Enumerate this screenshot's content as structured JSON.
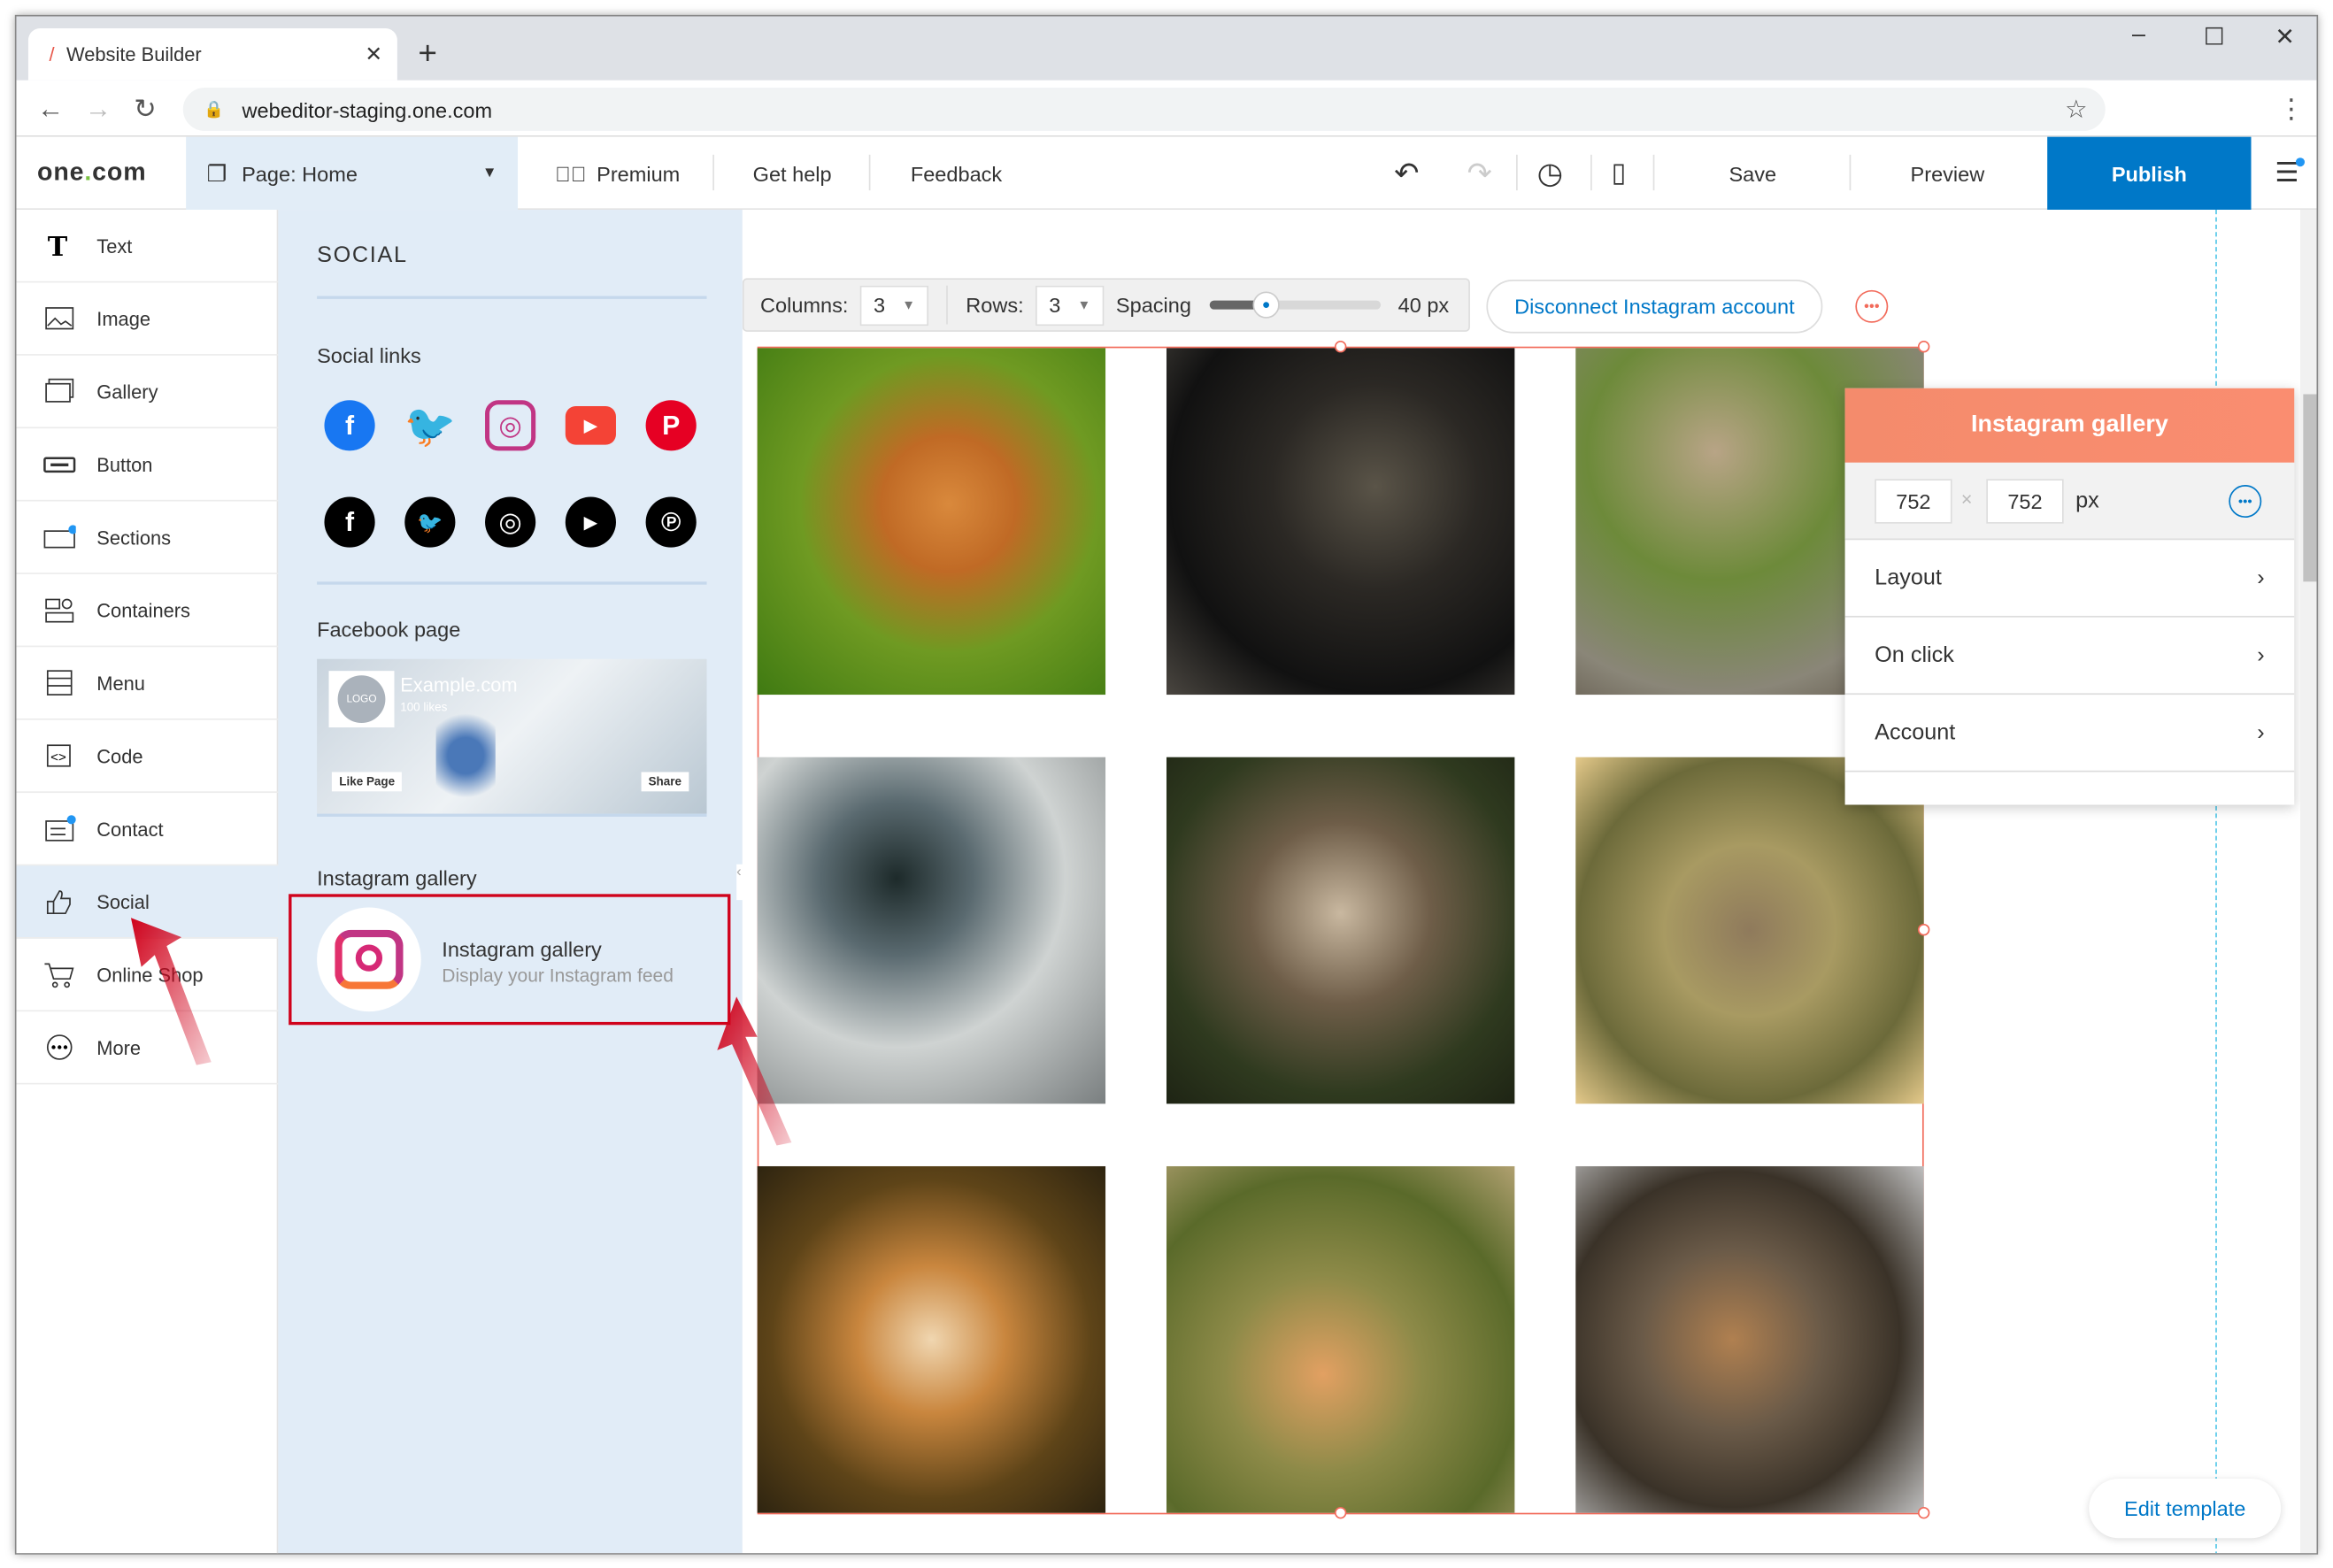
{
  "browser": {
    "tab_title": "Website Builder",
    "url": "webeditor-staging.one.com"
  },
  "header": {
    "logo": "one.com",
    "page_select": "Page: Home",
    "premium": "Premium",
    "get_help": "Get help",
    "feedback": "Feedback",
    "save": "Save",
    "preview": "Preview",
    "publish": "Publish"
  },
  "sidebar": {
    "items": [
      {
        "label": "Text",
        "icon": "text-icon"
      },
      {
        "label": "Image",
        "icon": "image-icon"
      },
      {
        "label": "Gallery",
        "icon": "gallery-icon"
      },
      {
        "label": "Button",
        "icon": "button-icon"
      },
      {
        "label": "Sections",
        "icon": "sections-icon"
      },
      {
        "label": "Containers",
        "icon": "containers-icon"
      },
      {
        "label": "Menu",
        "icon": "menu-icon"
      },
      {
        "label": "Code",
        "icon": "code-icon"
      },
      {
        "label": "Contact",
        "icon": "contact-icon"
      },
      {
        "label": "Social",
        "icon": "thumbs-up-icon",
        "active": true
      },
      {
        "label": "Online Shop",
        "icon": "cart-icon"
      },
      {
        "label": "More",
        "icon": "more-icon"
      }
    ]
  },
  "panel": {
    "title": "SOCIAL",
    "social_links": "Social links",
    "facebook_page": "Facebook page",
    "fb_preview": {
      "logo": "LOGO",
      "name": "Example.com",
      "likes": "100 likes",
      "like_page": "Like Page",
      "share": "Share"
    },
    "instagram_section": "Instagram gallery",
    "instagram_card": {
      "title": "Instagram gallery",
      "subtitle": "Display your Instagram feed"
    }
  },
  "toolbar": {
    "columns_label": "Columns:",
    "columns_value": "3",
    "rows_label": "Rows:",
    "rows_value": "3",
    "spacing_label": "Spacing",
    "spacing_value": "40 px",
    "spacing_level": 0.33,
    "disconnect": "Disconnect Instagram account"
  },
  "instagram_panel": {
    "title": "Instagram gallery",
    "width": "752",
    "height": "752",
    "unit": "px",
    "times": "×",
    "rows": [
      "Layout",
      "On click",
      "Account"
    ]
  },
  "edit_template": "Edit template",
  "colors": {
    "accent": "#0078c8",
    "selection": "#f26b5b",
    "panel_bg": "#e1ecf7",
    "annotation": "#d0021b"
  }
}
